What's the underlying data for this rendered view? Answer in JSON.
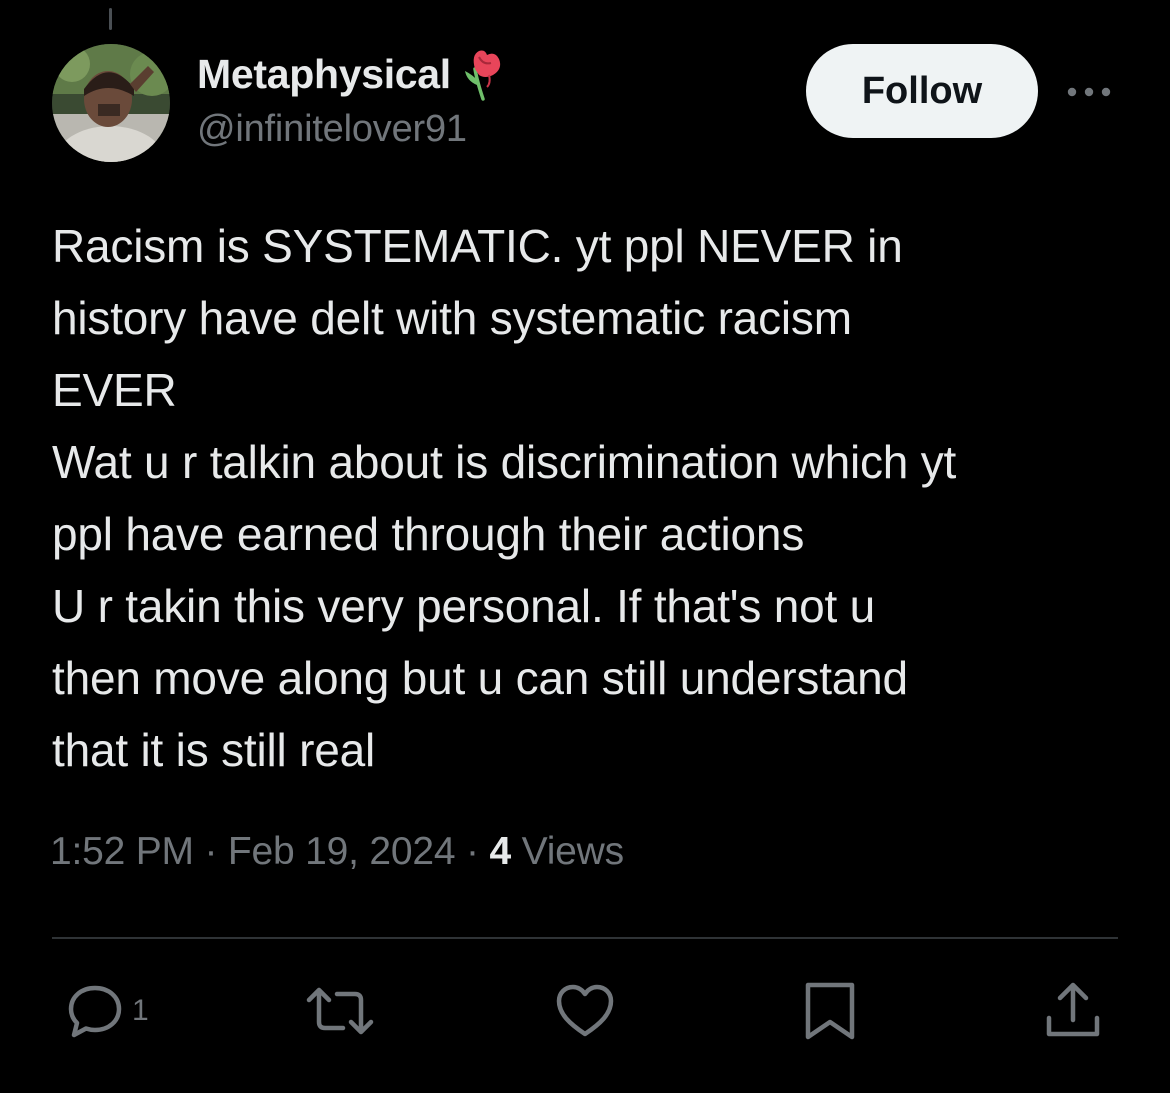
{
  "author": {
    "display_name": "Metaphysical",
    "handle": "@infinitelover91",
    "name_emoji": "wilted-rose-icon"
  },
  "header": {
    "follow_label": "Follow",
    "more_icon": "more-horizontal-icon"
  },
  "tweet": {
    "lines": [
      "Racism is SYSTEMATIC. yt ppl NEVER in",
      "history have delt with systematic racism",
      "EVER",
      "Wat u r talkin about is discrimination which yt",
      "ppl have earned through their actions",
      "U r takin this very personal. If that's not u",
      "then move along but u can still understand",
      "that it is still real"
    ]
  },
  "meta": {
    "time": "1:52 PM",
    "separator": "·",
    "date": "Feb 19, 2024",
    "views_count": "4",
    "views_label": "Views"
  },
  "actions": {
    "reply_count": "1",
    "icons": [
      "reply-icon",
      "retweet-icon",
      "like-icon",
      "bookmark-icon",
      "share-icon"
    ]
  },
  "colors": {
    "background": "#000000",
    "primary_text": "#e7e9ea",
    "secondary_text": "#71767b",
    "follow_bg": "#eff3f4",
    "divider": "#2f3336",
    "rose_petal": "#e8455a",
    "rose_stem": "#6fbf6a"
  }
}
